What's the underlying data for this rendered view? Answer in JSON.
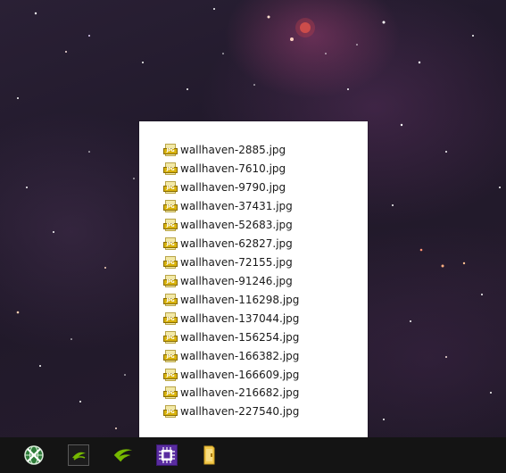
{
  "popup": {
    "files": [
      {
        "name": "wallhaven-2885.jpg",
        "icon": "jpg-file-icon"
      },
      {
        "name": "wallhaven-7610.jpg",
        "icon": "jpg-file-icon"
      },
      {
        "name": "wallhaven-9790.jpg",
        "icon": "jpg-file-icon"
      },
      {
        "name": "wallhaven-37431.jpg",
        "icon": "jpg-file-icon"
      },
      {
        "name": "wallhaven-52683.jpg",
        "icon": "jpg-file-icon"
      },
      {
        "name": "wallhaven-62827.jpg",
        "icon": "jpg-file-icon"
      },
      {
        "name": "wallhaven-72155.jpg",
        "icon": "jpg-file-icon"
      },
      {
        "name": "wallhaven-91246.jpg",
        "icon": "jpg-file-icon"
      },
      {
        "name": "wallhaven-116298.jpg",
        "icon": "jpg-file-icon"
      },
      {
        "name": "wallhaven-137044.jpg",
        "icon": "jpg-file-icon"
      },
      {
        "name": "wallhaven-156254.jpg",
        "icon": "jpg-file-icon"
      },
      {
        "name": "wallhaven-166382.jpg",
        "icon": "jpg-file-icon"
      },
      {
        "name": "wallhaven-166609.jpg",
        "icon": "jpg-file-icon"
      },
      {
        "name": "wallhaven-216682.jpg",
        "icon": "jpg-file-icon"
      },
      {
        "name": "wallhaven-227540.jpg",
        "icon": "jpg-file-icon"
      }
    ],
    "icon_badge_text": "JPG"
  },
  "taskbar": {
    "icons": [
      {
        "name": "network-globe-icon",
        "color": "#3da34a"
      },
      {
        "name": "nvidia-control-panel-icon",
        "color": "#76b900"
      },
      {
        "name": "nvidia-geforce-icon",
        "color": "#76b900"
      },
      {
        "name": "cpu-chip-icon",
        "color": "#5a2ca0"
      },
      {
        "name": "file-explorer-folder-icon",
        "color": "#f2c94c"
      }
    ]
  },
  "colors": {
    "taskbar_bg": "#141414",
    "popup_bg": "#ffffff",
    "wallpaper_base": "#1f1829"
  }
}
